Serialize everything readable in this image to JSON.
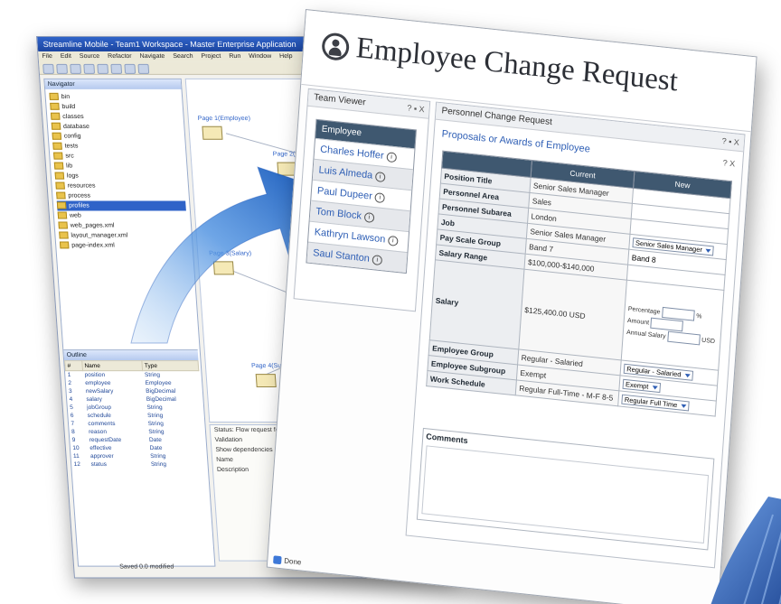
{
  "ide": {
    "title": "Streamline Mobile - Team1 Workspace - Master Enterprise Application",
    "menu": [
      "File",
      "Edit",
      "Source",
      "Refactor",
      "Navigate",
      "Search",
      "Project",
      "Run",
      "Window",
      "Help"
    ],
    "left_tab": "Navigator",
    "tree": [
      "bin",
      "build",
      "classes",
      "database",
      "config",
      "tests",
      "src",
      "lib",
      "logs",
      "resources",
      "process",
      "profiles",
      "web",
      "web_pages.xml",
      "layout_manager.xml",
      "page-index.xml"
    ],
    "outline_tab": "Outline",
    "outline_cols": [
      "#",
      "Name",
      "Type"
    ],
    "outline_rows": [
      [
        "1",
        "position",
        "String"
      ],
      [
        "2",
        "employee",
        "Employee"
      ],
      [
        "3",
        "newSalary",
        "BigDecimal"
      ],
      [
        "4",
        "salary",
        "BigDecimal"
      ],
      [
        "5",
        "jobGroup",
        "String"
      ],
      [
        "6",
        "schedule",
        "String"
      ],
      [
        "7",
        "comments",
        "String"
      ],
      [
        "8",
        "reason",
        "String"
      ],
      [
        "9",
        "requestDate",
        "Date"
      ],
      [
        "10",
        "effective",
        "Date"
      ],
      [
        "11",
        "approver",
        "String"
      ],
      [
        "12",
        "status",
        "String"
      ]
    ],
    "canvas_labels": [
      "Page 1(Employee)",
      "Page 2(PersonalInfo)",
      "Page 3(Salary)",
      "Page 4(Summary)"
    ],
    "bottom_lines": [
      "Status: Flow request for team viewer created",
      "Validation",
      "Show dependencies",
      "Name",
      "Description"
    ],
    "status_text": "Saved 0.0  modified"
  },
  "ecr": {
    "title": "Employee Change Request",
    "team_viewer": {
      "title": "Team Viewer",
      "controls": "? ▪ X",
      "header": "Employee",
      "employees": [
        "Charles Hoffer",
        "Luis Almeda",
        "Paul Dupeer",
        "Tom Block",
        "Kathryn Lawson",
        "Saul Stanton"
      ]
    },
    "pcr": {
      "title": "Personnel Change Request",
      "controls": "? ▪ X",
      "subtitle": "Proposals or Awards of Employee",
      "close": "? X",
      "col_current": "Current",
      "col_new": "New",
      "rows": [
        {
          "label": "Position Title",
          "current": "Senior Sales Manager",
          "new": ""
        },
        {
          "label": "Personnel Area",
          "current": "Sales",
          "new": ""
        },
        {
          "label": "Personnel Subarea",
          "current": "London",
          "new": ""
        },
        {
          "label": "Job",
          "current": "Senior Sales Manager",
          "new": "Senior Sales Manager"
        },
        {
          "label": "Pay Scale Group",
          "current": "Band 7",
          "new": "Band 8"
        },
        {
          "label": "Salary Range",
          "current": "$100,000-$140,000",
          "new": ""
        }
      ],
      "salary": {
        "label": "Salary",
        "current": "$125,400.00 USD",
        "percentage_label": "Percentage",
        "percentage_unit": "%",
        "amount_label": "Amount",
        "annual_label": "Annual Salary",
        "currency": "USD"
      },
      "rows_lower": [
        {
          "label": "Employee Group",
          "current": "Regular - Salaried",
          "new": "Regular - Salaried"
        },
        {
          "label": "Employee Subgroup",
          "current": "Exempt",
          "new": "Exempt"
        },
        {
          "label": "Work Schedule",
          "current": "Regular Full-Time - M-F 8-5",
          "new": "Regular Full Time"
        }
      ],
      "comments_label": "Comments"
    },
    "status": "Done"
  },
  "colors": {
    "header_blue": "#3f5870",
    "link_blue": "#2f5fb5",
    "arrow_blue": "#1f6fd0",
    "ide_title": "#2f63c8"
  }
}
